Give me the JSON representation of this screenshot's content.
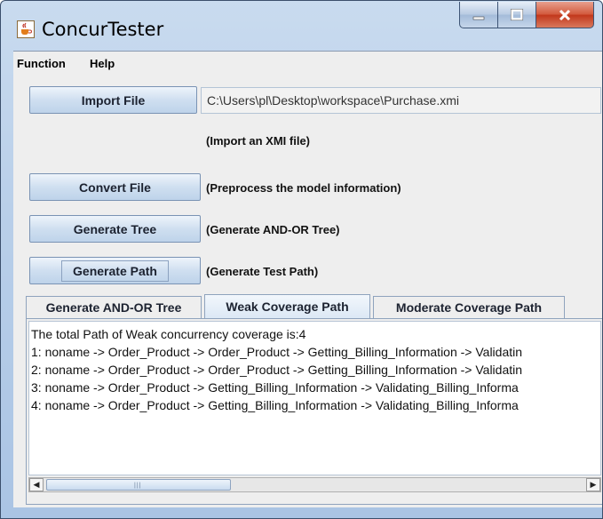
{
  "window": {
    "title": "ConcurTester"
  },
  "menu": [
    {
      "label": "Function"
    },
    {
      "label": "Help"
    }
  ],
  "import": {
    "button_label": "Import File",
    "file_path": "C:\\Users\\pl\\Desktop\\workspace\\Purchase.xmi",
    "hint": "(Import an XMI file)"
  },
  "convert": {
    "button_label": "Convert  File",
    "hint": "(Preprocess the model information)"
  },
  "tree": {
    "button_label": "Generate Tree",
    "hint": "(Generate AND-OR Tree)"
  },
  "path": {
    "button_label": "Generate Path",
    "hint": "(Generate Test Path)"
  },
  "tabs": [
    {
      "label": "Generate AND-OR Tree"
    },
    {
      "label": "Weak Coverage Path",
      "active": true
    },
    {
      "label": "Moderate Coverage Path"
    }
  ],
  "output": {
    "lines": [
      "The total Path of Weak concurrency coverage is:4",
      "1: noname -> Order_Product -> Order_Product -> Getting_Billing_Information -> Validatin",
      "2: noname -> Order_Product -> Order_Product -> Getting_Billing_Information -> Validatin",
      "3: noname -> Order_Product -> Getting_Billing_Information -> Validating_Billing_Informa",
      "4: noname -> Order_Product -> Getting_Billing_Information -> Validating_Billing_Informa"
    ]
  },
  "icons": {
    "app": "java-coffee-cup-icon",
    "minimize": "minimize-icon",
    "maximize": "maximize-icon",
    "close": "close-icon"
  }
}
